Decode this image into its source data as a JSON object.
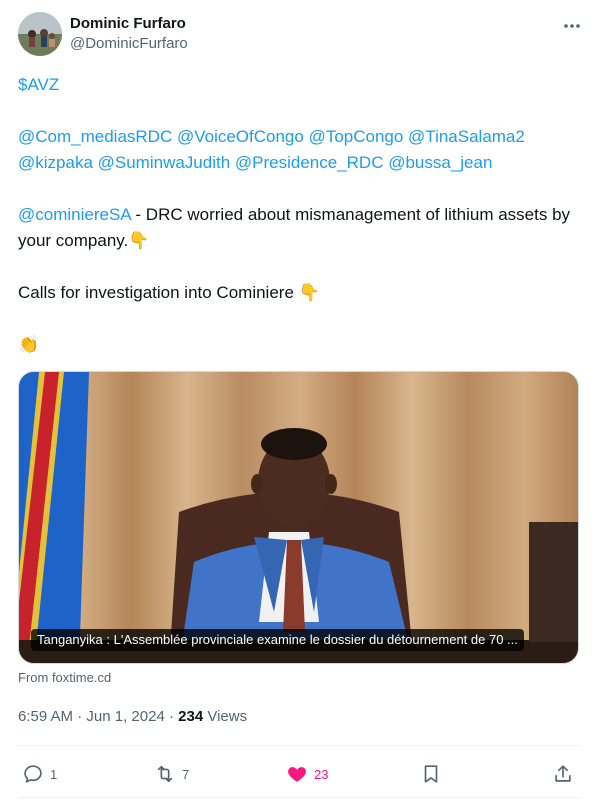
{
  "author": {
    "display_name": "Dominic Furfaro",
    "handle": "@DominicFurfaro",
    "avatar_icon": "profile-photo"
  },
  "tweet": {
    "cashtag": "$AVZ",
    "mentions_line1": "@Com_mediasRDC @VoiceOfCongo @TopCongo @TinaSalama2",
    "mentions_line2": "@kizpaka @SuminwaJudith @Presidence_RDC @bussa_jean",
    "reply_mention": "@cominiereSA",
    "reply_text": " - DRC worried about mismanagement of lithium assets by your company.",
    "emoji_point_down": "👇",
    "line_calls": "Calls for investigation into Cominiere ",
    "emoji_clap": "👏"
  },
  "media": {
    "caption": "Tanganyika : L'Assemblée provinciale examine le dossier du détournement de 70 ..."
  },
  "source": "From foxtime.cd",
  "meta": {
    "time": "6:59 AM",
    "separator": " · ",
    "date": "Jun 1, 2024",
    "views_count": "234",
    "views_label": " Views"
  },
  "actions": {
    "replies": "1",
    "reposts": "7",
    "likes": "23"
  },
  "colors": {
    "link": "#1d9bf0",
    "like": "#f91880",
    "muted": "#536471"
  }
}
